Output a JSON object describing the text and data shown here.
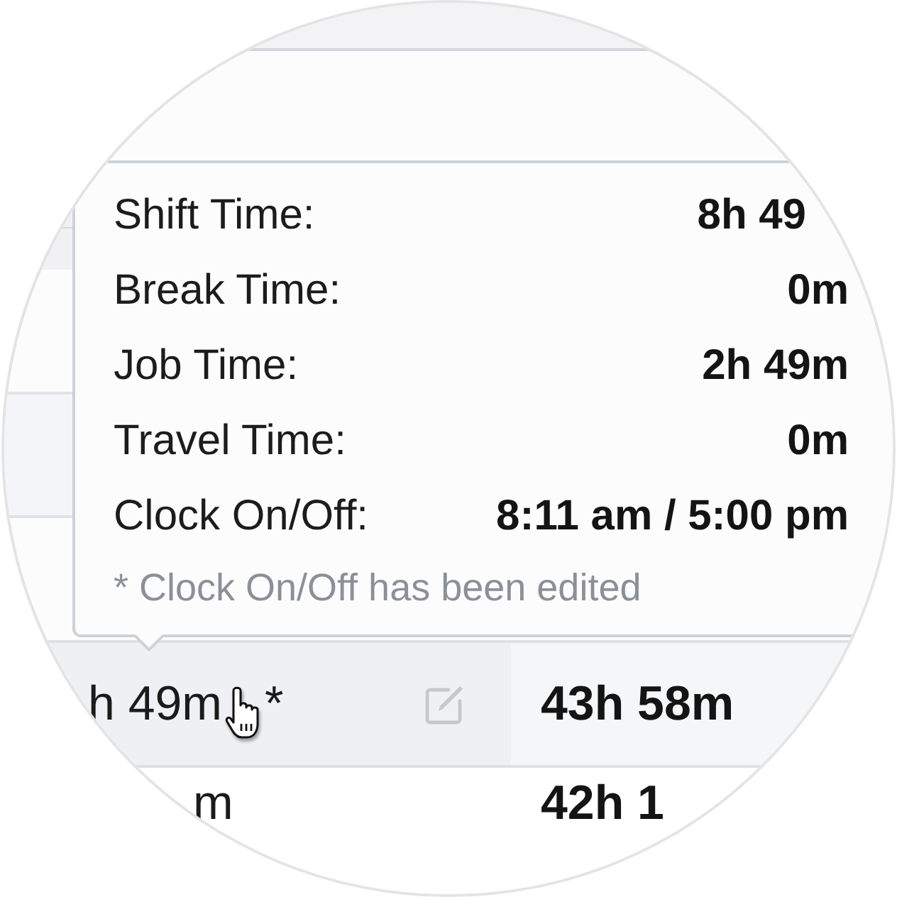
{
  "tooltip": {
    "rows": [
      {
        "label": "Shift Time:",
        "value": "8h 49"
      },
      {
        "label": "Break Time:",
        "value": "0m"
      },
      {
        "label": "Job Time:",
        "value": "2h 49m"
      },
      {
        "label": "Travel Time:",
        "value": "0m"
      },
      {
        "label": "Clock On/Off:",
        "value": "8:11 am / 5:00 pm"
      }
    ],
    "note": "* Clock On/Off has been edited"
  },
  "table": {
    "rows": [
      {
        "column_1": "h 49m",
        "edited_mark": "*",
        "column_2": "43h 58m",
        "hovered": true
      },
      {
        "column_1": "m",
        "column_2": "42h 1",
        "hovered": false
      }
    ]
  }
}
